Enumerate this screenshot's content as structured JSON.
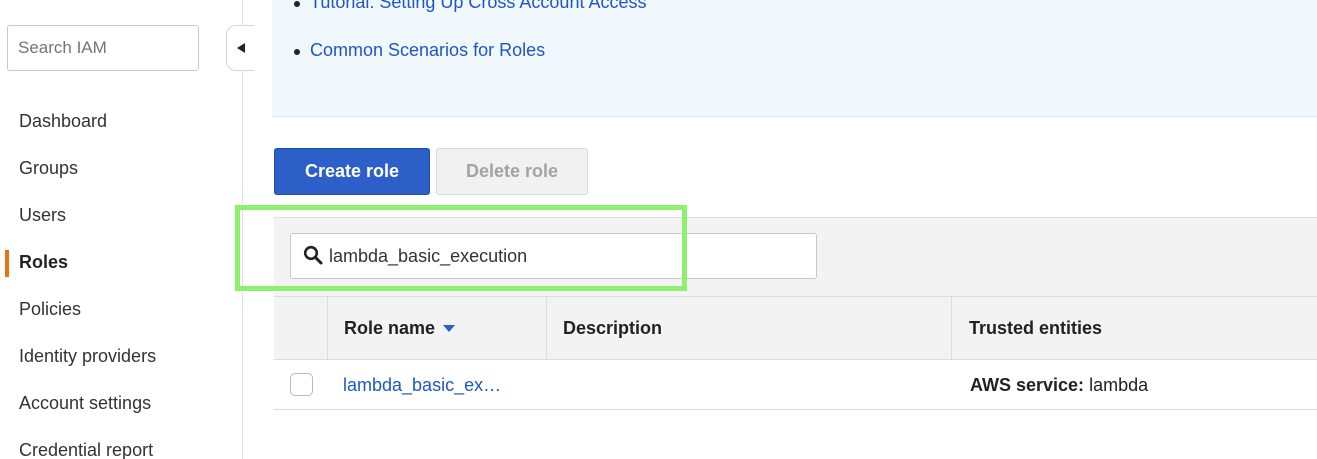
{
  "sidebar": {
    "search_placeholder": "Search IAM",
    "items": [
      {
        "label": "Dashboard"
      },
      {
        "label": "Groups"
      },
      {
        "label": "Users"
      },
      {
        "label": "Roles",
        "active": true
      },
      {
        "label": "Policies"
      },
      {
        "label": "Identity providers"
      },
      {
        "label": "Account settings"
      },
      {
        "label": "Credential report"
      }
    ]
  },
  "info": {
    "links": [
      {
        "label": "Tutorial: Setting Up Cross Account Access"
      },
      {
        "label": "Common Scenarios for Roles"
      }
    ]
  },
  "toolbar": {
    "create_label": "Create role",
    "delete_label": "Delete role"
  },
  "filter": {
    "value": "lambda_basic_execution",
    "icon": "search-icon"
  },
  "table": {
    "columns": [
      {
        "label": "Role name",
        "sorted": "desc"
      },
      {
        "label": "Description"
      },
      {
        "label": "Trusted entities"
      }
    ],
    "rows": [
      {
        "role_name": "lambda_basic_ex…",
        "description": "",
        "trusted_prefix": "AWS service:",
        "trusted_value": "lambda"
      }
    ]
  },
  "colors": {
    "accent": "#2d5fc9",
    "link": "#1e56c6",
    "active_marker": "#ec7211",
    "highlight": "#8ef06d",
    "info_bg": "#f0f7fd"
  }
}
